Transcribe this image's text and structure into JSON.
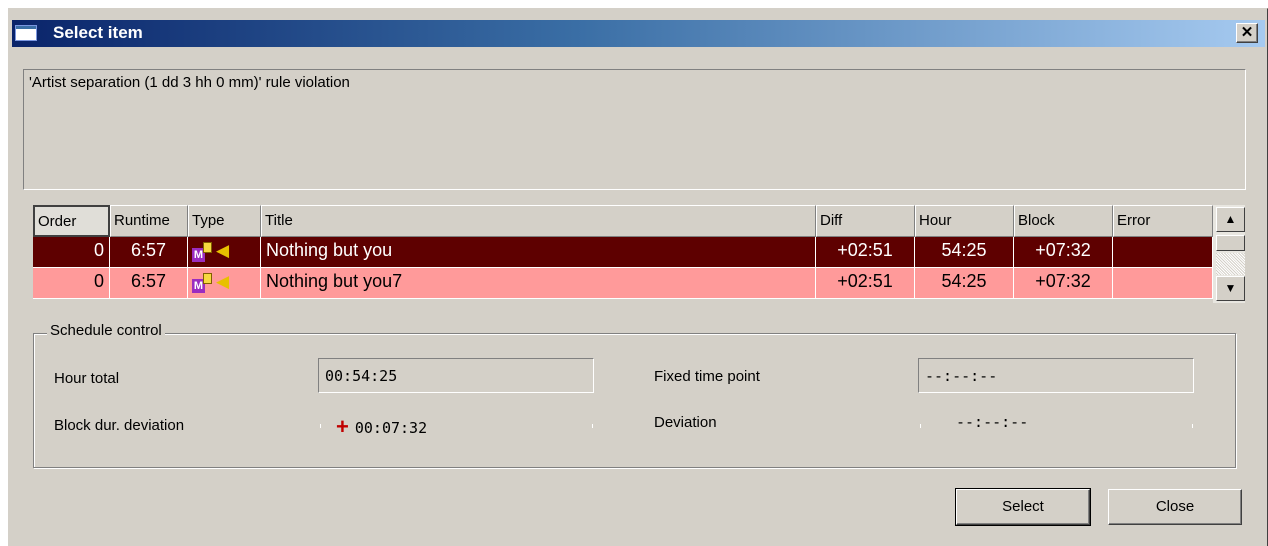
{
  "window": {
    "title": "Select item",
    "close_glyph": "✕"
  },
  "message": "'Artist separation (1 dd  3 hh  0 mm)' rule violation",
  "table": {
    "columns": [
      "Order",
      "Runtime",
      "Type",
      "Title",
      "Diff",
      "Hour",
      "Block",
      "Error"
    ],
    "rows": [
      {
        "order": "0",
        "runtime": "6:57",
        "type_icon": "M",
        "title": "Nothing but you",
        "diff": "+02:51",
        "hour": "54:25",
        "block": "+07:32",
        "error": "",
        "state": "selected"
      },
      {
        "order": "0",
        "runtime": "6:57",
        "type_icon": "M",
        "title": "Nothing but you7",
        "diff": "+02:51",
        "hour": "54:25",
        "block": "+07:32",
        "error": "",
        "state": "normal"
      }
    ],
    "row_colors": {
      "selected": "#5e0000",
      "normal": "#ff9a9a"
    }
  },
  "schedule": {
    "legend": "Schedule control",
    "hour_total_label": "Hour total",
    "hour_total_value": "00:54:25",
    "block_dev_label": "Block dur. deviation",
    "block_dev_sign": "+",
    "block_dev_value": "00:07:32",
    "fixed_label": "Fixed time point",
    "fixed_value": "--:--:--",
    "deviation_label": "Deviation",
    "deviation_value": "--:--:--"
  },
  "buttons": {
    "select": "Select",
    "close": "Close"
  }
}
